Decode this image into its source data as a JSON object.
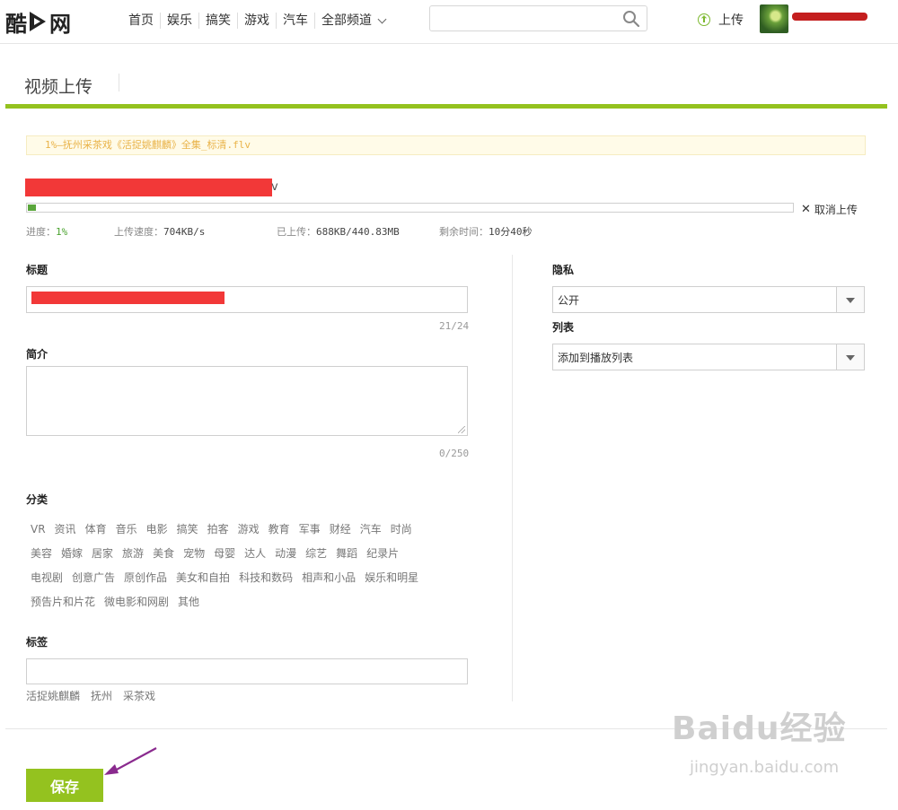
{
  "header": {
    "logo": {
      "left": "酷",
      "right": "网"
    },
    "nav": [
      "首页",
      "娱乐",
      "搞笑",
      "游戏",
      "汽车",
      "全部频道"
    ],
    "search_placeholder": "",
    "upload_label": "上传"
  },
  "page": {
    "title": "视频上传"
  },
  "notice": {
    "file_text": "1%—抚州采茶戏《活捉姚麒麟》全集_标清.flv"
  },
  "upload": {
    "file_name_tail": "v",
    "progress_percent": 1,
    "cancel_label": "取消上传",
    "stats": [
      {
        "label": "进度：",
        "value": "1%"
      },
      {
        "label": "上传速度：",
        "value": "704KB/s"
      },
      {
        "label": "已上传：",
        "value": "688KB/440.83MB"
      },
      {
        "label": "剩余时间：",
        "value": "10分40秒"
      }
    ]
  },
  "form": {
    "title_label": "标题",
    "title_count": "21/24",
    "intro_label": "简介",
    "intro_value": "",
    "intro_count": "0/250",
    "category_label": "分类",
    "categories": [
      [
        "VR",
        "资讯",
        "体育",
        "音乐",
        "电影",
        "搞笑",
        "拍客",
        "游戏",
        "教育",
        "军事",
        "财经",
        "汽车",
        "时尚"
      ],
      [
        "美容",
        "婚嫁",
        "居家",
        "旅游",
        "美食",
        "宠物",
        "母婴",
        "达人",
        "动漫",
        "综艺",
        "舞蹈",
        "纪录片"
      ],
      [
        "电视剧",
        "创意广告",
        "原创作品",
        "美女和自拍",
        "科技和数码",
        "相声和小品",
        "娱乐和明星"
      ],
      [
        "预告片和片花",
        "微电影和网剧",
        "其他"
      ]
    ],
    "tags_label": "标签",
    "tags_value": "",
    "tag_suggestions": [
      "活捉姚麒麟",
      "抚州",
      "采茶戏"
    ],
    "privacy_label": "隐私",
    "privacy_value": "公开",
    "list_label": "列表",
    "list_value": "添加到播放列表",
    "save_label": "保存"
  },
  "watermark": {
    "brand": "Baidu经验",
    "url": "jingyan.baidu.com"
  },
  "colors": {
    "accent": "#94c21f",
    "progress": "#5aa63c",
    "redaction": "#f23838",
    "notice_text": "#e9b349"
  }
}
